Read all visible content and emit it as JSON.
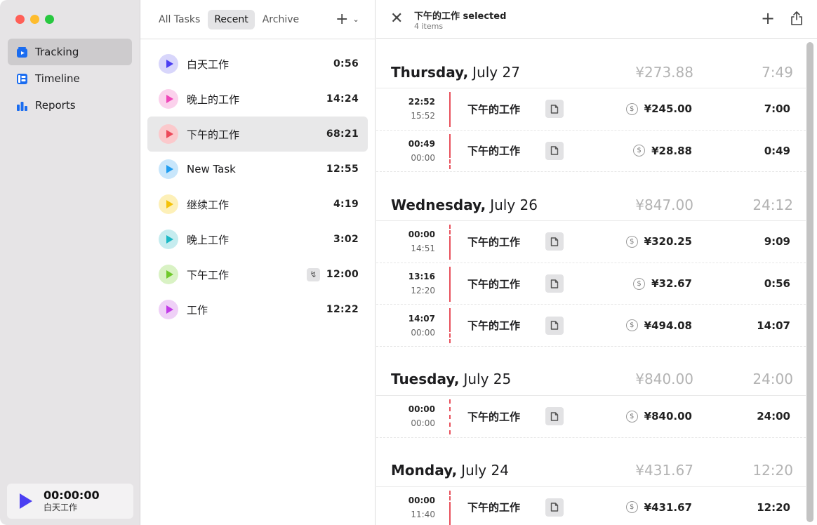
{
  "sidebar": {
    "nav": [
      {
        "label": "Tracking",
        "icon": "tracking-icon",
        "active": true
      },
      {
        "label": "Timeline",
        "icon": "timeline-icon",
        "active": false
      },
      {
        "label": "Reports",
        "icon": "reports-icon",
        "active": false
      }
    ],
    "player": {
      "time": "00:00:00",
      "task": "白天工作"
    }
  },
  "middle": {
    "tabs": [
      "All Tasks",
      "Recent",
      "Archive"
    ],
    "active_tab": "Recent",
    "tasks": [
      {
        "name": "白天工作",
        "time": "0:56",
        "color": "#d8d6fb",
        "play": "#4b3ff2",
        "bolt": false,
        "selected": false
      },
      {
        "name": "晚上的工作",
        "time": "14:24",
        "color": "#fbd1ec",
        "play": "#ef45b8",
        "bolt": false,
        "selected": false
      },
      {
        "name": "下午的工作",
        "time": "68:21",
        "color": "#fbc9cc",
        "play": "#ec4a5a",
        "bolt": false,
        "selected": true
      },
      {
        "name": "New Task",
        "time": "12:55",
        "color": "#c8e6fb",
        "play": "#1f9df0",
        "bolt": false,
        "selected": false
      },
      {
        "name": "继续工作",
        "time": "4:19",
        "color": "#fdf0b8",
        "play": "#f4c20a",
        "bolt": false,
        "selected": false
      },
      {
        "name": "晚上工作",
        "time": "3:02",
        "color": "#c5ecef",
        "play": "#1ab8c5",
        "bolt": false,
        "selected": false
      },
      {
        "name": "下午工作",
        "time": "12:00",
        "color": "#d9f2c4",
        "play": "#70c92c",
        "bolt": true,
        "selected": false
      },
      {
        "name": "工作",
        "time": "12:22",
        "color": "#efd0f7",
        "play": "#c13ae7",
        "bolt": false,
        "selected": false
      }
    ]
  },
  "detail": {
    "title": "下午的工作 selected",
    "subtitle": "4 items",
    "days": [
      {
        "weekday": "Thursday,",
        "date": "July 27",
        "amount": "¥273.88",
        "duration": "7:49",
        "entries": [
          {
            "end": "22:52",
            "start": "15:52",
            "name": "下午的工作",
            "amount": "¥245.00",
            "duration": "7:00",
            "bar": "solid"
          },
          {
            "end": "00:49",
            "start": "00:00",
            "name": "下午的工作",
            "amount": "¥28.88",
            "duration": "0:49",
            "bar": "half"
          }
        ]
      },
      {
        "weekday": "Wednesday,",
        "date": "July 26",
        "amount": "¥847.00",
        "duration": "24:12",
        "entries": [
          {
            "end": "00:00",
            "start": "14:51",
            "name": "下午的工作",
            "amount": "¥320.25",
            "duration": "9:09",
            "bar": "top-dash"
          },
          {
            "end": "13:16",
            "start": "12:20",
            "name": "下午的工作",
            "amount": "¥32.67",
            "duration": "0:56",
            "bar": "solid"
          },
          {
            "end": "14:07",
            "start": "00:00",
            "name": "下午的工作",
            "amount": "¥494.08",
            "duration": "14:07",
            "bar": "half"
          }
        ]
      },
      {
        "weekday": "Tuesday,",
        "date": "July 25",
        "amount": "¥840.00",
        "duration": "24:00",
        "entries": [
          {
            "end": "00:00",
            "start": "00:00",
            "name": "下午的工作",
            "amount": "¥840.00",
            "duration": "24:00",
            "bar": "dashed"
          }
        ]
      },
      {
        "weekday": "Monday,",
        "date": "July 24",
        "amount": "¥431.67",
        "duration": "12:20",
        "entries": [
          {
            "end": "00:00",
            "start": "11:40",
            "name": "下午的工作",
            "amount": "¥431.67",
            "duration": "12:20",
            "bar": "top-dash"
          }
        ]
      }
    ]
  }
}
